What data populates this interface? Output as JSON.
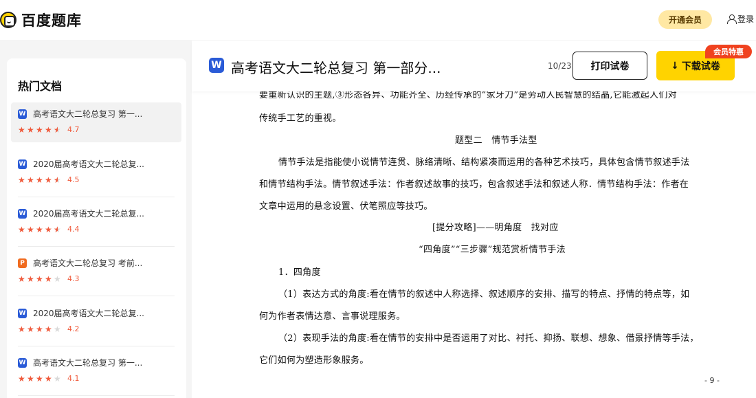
{
  "header": {
    "logo_text": "百度题库",
    "vip_label": "开通会员",
    "login_label": "登录"
  },
  "sidebar": {
    "title": "热门文档",
    "items": [
      {
        "title": "高考语文大二轮总复习 第一...",
        "type": "W",
        "rating": "4.7"
      },
      {
        "title": "2020届高考语文大二轮总复...",
        "type": "W",
        "rating": "4.5"
      },
      {
        "title": "2020届高考语文大二轮总复...",
        "type": "W",
        "rating": "4.4"
      },
      {
        "title": "高考语文大二轮总复习 考前...",
        "type": "P",
        "rating": "4.3"
      },
      {
        "title": "2020届高考语文大二轮总复...",
        "type": "W",
        "rating": "4.2"
      },
      {
        "title": "高考语文大二轮总复习 第一...",
        "type": "W",
        "rating": "4.1"
      }
    ]
  },
  "document": {
    "icon_letter": "W",
    "title": "高考语文大二轮总复习 第一部分...",
    "page_count": "10/23",
    "print_label": "打印试卷",
    "download_label": "下载试卷",
    "badge_label": "会员特惠",
    "page_number": "- 9 -",
    "lines": [
      "要重新认识的主题,③形态各异、功能齐全、历经传承的“家牙刀”是劳动人民智慧的结晶,它能激起人们对",
      "传统手工艺的重视。",
      "题型二　情节手法型",
      "情节手法是指能使小说情节连贯、脉络清晰、结构紧凑而运用的各种艺术技巧，具体包含情节叙述手法",
      "和情节结构手法。情节叙述手法：作者叙述故事的技巧，包含叙述手法和叙述人称．情节结构手法：作者在",
      "文章中运用的悬念设置、伏笔照应等技巧。",
      "[提分攻略]——明角度　找对应",
      "“四角度”“三步骤”规范赏析情节手法",
      "1．四角度",
      "（1）表达方式的角度:看在情节的叙述中人称选择、叙述顺序的安排、描写的特点、抒情的特点等，如",
      "何为作者表情达意、言事说理服务。",
      "（2）表现手法的角度:看在情节的安排中是否运用了对比、衬托、抑扬、联想、想象、借景抒情等手法，",
      "它们如何为塑造形象服务。"
    ]
  },
  "colors": {
    "brand_yellow": "#ffd300",
    "star_red": "#f05a3c",
    "badge_red": "#f0421f",
    "word_blue": "#2a5bd7",
    "ppt_orange": "#f06b1f"
  }
}
